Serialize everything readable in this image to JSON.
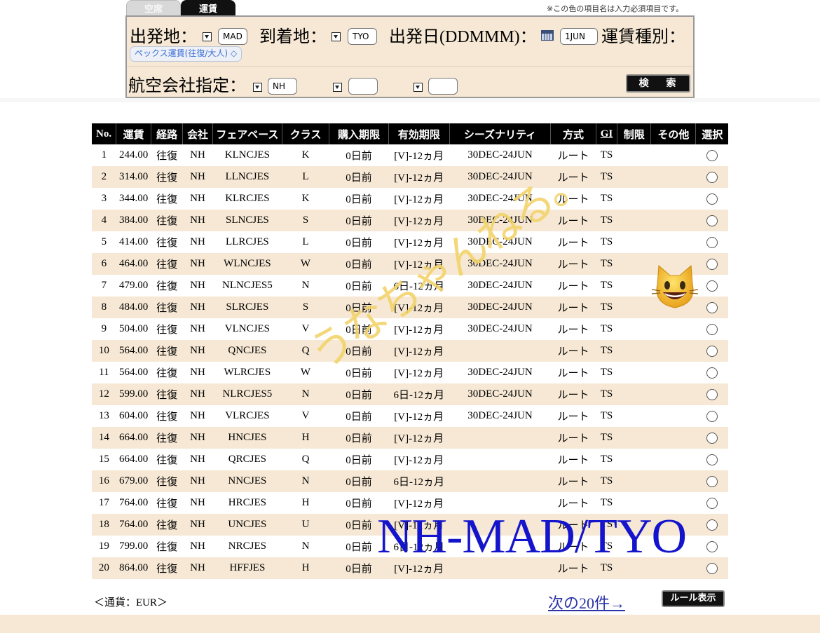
{
  "tabs": [
    {
      "label": "空席",
      "active": false
    },
    {
      "label": "運賃",
      "active": true
    }
  ],
  "required_note": "※この色の項目名は入力必須項目です。",
  "form": {
    "origin_label": "出発地：",
    "origin_value": "MAD",
    "destination_label": "到着地：",
    "destination_value": "TYO",
    "date_label": "出発日(DDMMM)：",
    "date_value": "1JUN",
    "fare_type_label": "運賃種別：",
    "fare_type_value": "ペックス運賃(往復/大人) ◇",
    "airline_label": "航空会社指定：",
    "airline_values": [
      "NH",
      "",
      ""
    ],
    "search_button": "検 索"
  },
  "table": {
    "headers": [
      "No.",
      "運賃",
      "経路",
      "会社",
      "フェアベース",
      "クラス",
      "購入期限",
      "有効期限",
      "シーズナリティ",
      "方式",
      "GI",
      "制限",
      "その他",
      "選択"
    ],
    "rows": [
      [
        "1",
        "244.00",
        "往復",
        "NH",
        "KLNCJES",
        "K",
        "0日前",
        "[V]-12ヵ月",
        "30DEC-24JUN",
        "ルート",
        "TS",
        "",
        ""
      ],
      [
        "2",
        "314.00",
        "往復",
        "NH",
        "LLNCJES",
        "L",
        "0日前",
        "[V]-12ヵ月",
        "30DEC-24JUN",
        "ルート",
        "TS",
        "",
        ""
      ],
      [
        "3",
        "344.00",
        "往復",
        "NH",
        "KLRCJES",
        "K",
        "0日前",
        "[V]-12ヵ月",
        "30DEC-24JUN",
        "ルート",
        "TS",
        "",
        ""
      ],
      [
        "4",
        "384.00",
        "往復",
        "NH",
        "SLNCJES",
        "S",
        "0日前",
        "[V]-12ヵ月",
        "30DEC-24JUN",
        "ルート",
        "TS",
        "",
        ""
      ],
      [
        "5",
        "414.00",
        "往復",
        "NH",
        "LLRCJES",
        "L",
        "0日前",
        "[V]-12ヵ月",
        "30DEC-24JUN",
        "ルート",
        "TS",
        "",
        ""
      ],
      [
        "6",
        "464.00",
        "往復",
        "NH",
        "WLNCJES",
        "W",
        "0日前",
        "[V]-12ヵ月",
        "30DEC-24JUN",
        "ルート",
        "TS",
        "",
        ""
      ],
      [
        "7",
        "479.00",
        "往復",
        "NH",
        "NLNCJES5",
        "N",
        "0日前",
        "6日-12ヵ月",
        "30DEC-24JUN",
        "ルート",
        "TS",
        "",
        ""
      ],
      [
        "8",
        "484.00",
        "往復",
        "NH",
        "SLRCJES",
        "S",
        "0日前",
        "[V]-12ヵ月",
        "30DEC-24JUN",
        "ルート",
        "TS",
        "",
        ""
      ],
      [
        "9",
        "504.00",
        "往復",
        "NH",
        "VLNCJES",
        "V",
        "0日前",
        "[V]-12ヵ月",
        "30DEC-24JUN",
        "ルート",
        "TS",
        "",
        ""
      ],
      [
        "10",
        "564.00",
        "往復",
        "NH",
        "QNCJES",
        "Q",
        "0日前",
        "[V]-12ヵ月",
        "",
        "ルート",
        "TS",
        "",
        ""
      ],
      [
        "11",
        "564.00",
        "往復",
        "NH",
        "WLRCJES",
        "W",
        "0日前",
        "[V]-12ヵ月",
        "30DEC-24JUN",
        "ルート",
        "TS",
        "",
        ""
      ],
      [
        "12",
        "599.00",
        "往復",
        "NH",
        "NLRCJES5",
        "N",
        "0日前",
        "6日-12ヵ月",
        "30DEC-24JUN",
        "ルート",
        "TS",
        "",
        ""
      ],
      [
        "13",
        "604.00",
        "往復",
        "NH",
        "VLRCJES",
        "V",
        "0日前",
        "[V]-12ヵ月",
        "30DEC-24JUN",
        "ルート",
        "TS",
        "",
        ""
      ],
      [
        "14",
        "664.00",
        "往復",
        "NH",
        "HNCJES",
        "H",
        "0日前",
        "[V]-12ヵ月",
        "",
        "ルート",
        "TS",
        "",
        ""
      ],
      [
        "15",
        "664.00",
        "往復",
        "NH",
        "QRCJES",
        "Q",
        "0日前",
        "[V]-12ヵ月",
        "",
        "ルート",
        "TS",
        "",
        ""
      ],
      [
        "16",
        "679.00",
        "往復",
        "NH",
        "NNCJES",
        "N",
        "0日前",
        "6日-12ヵ月",
        "",
        "ルート",
        "TS",
        "",
        ""
      ],
      [
        "17",
        "764.00",
        "往復",
        "NH",
        "HRCJES",
        "H",
        "0日前",
        "[V]-12ヵ月",
        "",
        "ルート",
        "TS",
        "",
        ""
      ],
      [
        "18",
        "764.00",
        "往復",
        "NH",
        "UNCJES",
        "U",
        "0日前",
        "[V]-12ヵ月",
        "",
        "ルート",
        "TS",
        "",
        ""
      ],
      [
        "19",
        "799.00",
        "往復",
        "NH",
        "NRCJES",
        "N",
        "0日前",
        "6日-12ヵ月",
        "",
        "ルート",
        "TS",
        "",
        ""
      ],
      [
        "20",
        "864.00",
        "往復",
        "NH",
        "HFFJES",
        "H",
        "0日前",
        "[V]-12ヵ月",
        "",
        "ルート",
        "TS",
        "",
        ""
      ]
    ]
  },
  "footer": {
    "currency": "＜通貨：EUR＞",
    "next_link": "次の20件→",
    "rule_button": "ルール表示"
  },
  "overlays": {
    "handwriting": "うなちゃんねる。",
    "title": "NH-MAD/TYO",
    "emoji_icon": "grinning-cat-icon"
  },
  "colors": {
    "form_bg": "#f6e8d4",
    "header_bg": "#000000",
    "stripe": "#f6e8d4",
    "link": "#2a34a8",
    "overlay_title": "#1414cc",
    "handwriting": "#f2d36b"
  }
}
